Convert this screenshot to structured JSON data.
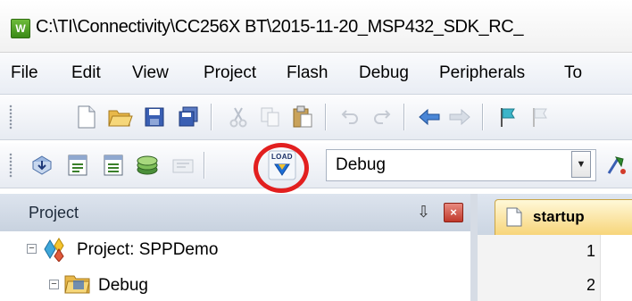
{
  "window": {
    "title": "C:\\TI\\Connectivity\\CC256X BT\\2015-11-20_MSP432_SDK_RC_"
  },
  "menu": [
    "File",
    "Edit",
    "View",
    "Project",
    "Flash",
    "Debug",
    "Peripherals",
    "To"
  ],
  "toolbar1": {
    "buttons": [
      "new-file-icon",
      "open-folder-icon",
      "save-icon",
      "save-all-icon",
      "cut-icon",
      "copy-icon",
      "paste-icon",
      "undo-icon",
      "redo-icon",
      "back-arrow-icon",
      "forward-arrow-icon",
      "bookmark-flag-icon",
      "flag-icon"
    ]
  },
  "toolbar2": {
    "buttons": [
      "build-target-icon",
      "compile-icon",
      "rebuild-icon",
      "batch-build-icon",
      "stop-build-icon"
    ],
    "load_button_label": "LOAD",
    "build_config": "Debug",
    "accent": "#e21f1f"
  },
  "project_panel": {
    "title": "Project",
    "pin_glyph": "⇩",
    "close_glyph": "×",
    "tree": [
      {
        "label": "Project: SPPDemo",
        "expander": "−",
        "icon": "project-icon"
      },
      {
        "label": "Debug",
        "expander": "−",
        "icon": "folder-icon"
      }
    ]
  },
  "editor": {
    "tab_label": "startup",
    "line_numbers": [
      "1",
      "2"
    ]
  }
}
